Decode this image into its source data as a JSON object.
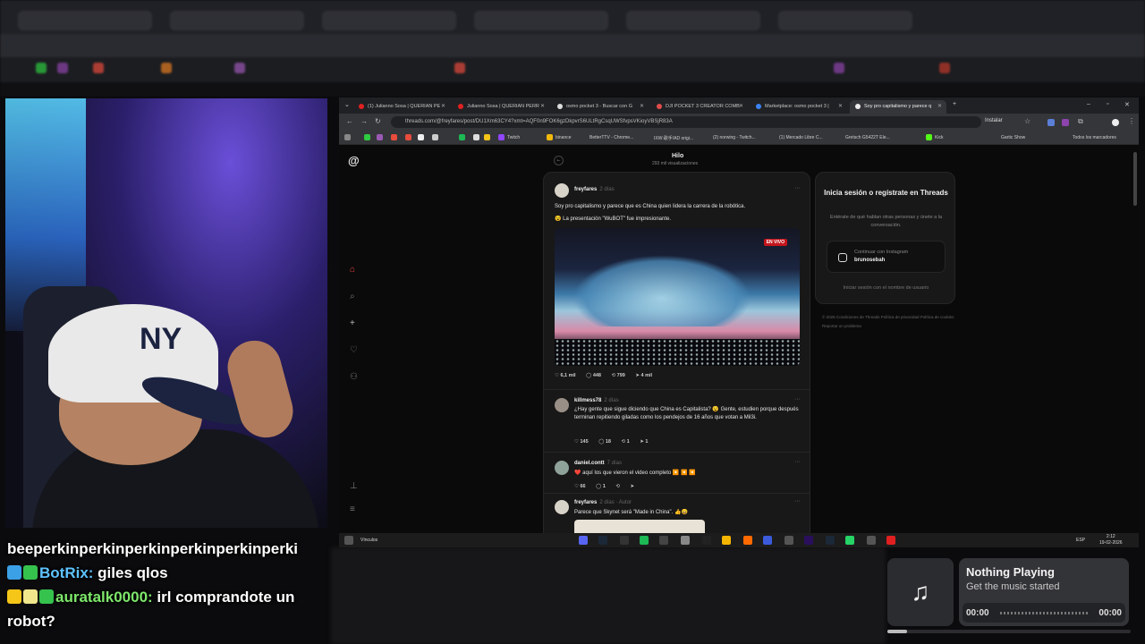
{
  "chat": {
    "line1": "beeperkinperkinperkinperkinperkinperki",
    "line2_user": "BotRix:",
    "line2_text": " giles qlos",
    "line3_user": "auratalk0000:",
    "line3_text": " irl comprandote un",
    "line4_text": "robot?"
  },
  "music": {
    "title": "Nothing Playing",
    "subtitle": "Get the music started",
    "time_current": "00:00",
    "time_total": "00:00",
    "progress": 0.08
  },
  "browser": {
    "tabs": [
      {
        "label": "(1) Julianno Sosa | QUERIAN PE",
        "color": "#e02020"
      },
      {
        "label": "Julianno Sosa | QUERIAN PERR",
        "color": "#e02020"
      },
      {
        "label": "osmo pocket 3 - Buscar con G",
        "color": "#dddddd"
      },
      {
        "label": "DJI POCKET 3 CREATOR COMB",
        "color": "#e24b4b"
      },
      {
        "label": "Marketplace: osmo pocket 3 |",
        "color": "#3b82f6"
      },
      {
        "label": "Soy pro capitalismo y parece q",
        "color": "#eeeeee"
      }
    ],
    "url": "threads.com/@freyfares/post/DU1Xm63CY4?xmt=AQF0n9FOK6gzDkpvrS6ULtRgCsqUWSfvpsVKioyVBSjR83A",
    "install_label": "Instalar",
    "bookmarks": [
      "Twitch",
      "binance",
      "BetterTTV - Chrome...",
      "IXW:歌手!AD origi...",
      "(2) norwing - Twitch...",
      "(1) Mercado Libre C...",
      "Gretsch G5422T Ele...",
      "Kick",
      "Gartic Show",
      "Todos los marcadores"
    ]
  },
  "threads": {
    "header_title": "Hilo",
    "header_sub": "293 mil visualizaciones",
    "posts": [
      {
        "user": "freyfares",
        "time": "2 días",
        "text1": "Soy pro capitalismo y parece que es China quien lidera la carrera de la robótica.",
        "text2": "😵 La presentación \"WuBOT\" fue impresionante.",
        "live_badge": "EN VIVO",
        "likes": "6,1 mil",
        "comments": "448",
        "reposts": "799",
        "shares": "4 mil"
      },
      {
        "user": "killmess78",
        "time": "2 días",
        "text": "¿Hay gente que sigue diciendo que China es Capitalista? 😧 Gente, estudien porque después terminan repitiendo giladas como los pendejos de 16 años que votan a Mil3i.",
        "likes": "145",
        "comments": "18",
        "reposts": "1",
        "shares": "1"
      },
      {
        "user": "daniel.contt",
        "time": "7 días",
        "text": "❤️ aquí los que vieron el video completo ◀️ ◀️ ◀️",
        "likes": "66",
        "comments": "1"
      },
      {
        "user": "freyfares",
        "time": "2 días · Autor",
        "text": "Parece que Skynet será \"Made in China\". 👍😄"
      }
    ],
    "login": {
      "heading": "Inicia sesión o regístrate en Threads",
      "para": "Entérate de qué hablan otras personas y únete a la conversación.",
      "btn_line1": "Continuar con Instagram",
      "btn_line2": "brunosebah",
      "alt": "Iniciar sesión con el nombre de usuario"
    },
    "footer": "© 2026   Condiciones de Threads   Política de privacidad   Política de cookies   Reportar un problema"
  },
  "taskbar": {
    "links_label": "Vínculos",
    "lang": "ESP",
    "time": "2:12",
    "date": "19-02-2026"
  }
}
